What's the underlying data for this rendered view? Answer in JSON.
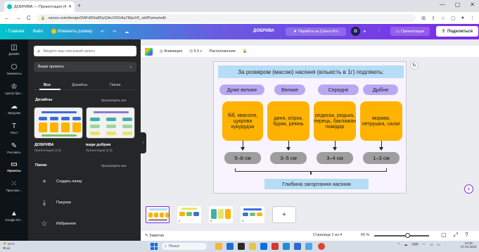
{
  "browser": {
    "tab_title": "ДОБРИВА — Презентация (4:3)",
    "url": "canva.com/design/DAFdD9a8DyQ/bcO5GAq78/jw1R_uk0Ppmw/edit",
    "nav": {
      "back": "←",
      "forward": "→",
      "reload": "C"
    }
  },
  "canva_bar": {
    "home": "Главная",
    "file": "Файл",
    "resize": "Изменить размер",
    "doc_name": "ДОБРИВА",
    "go_pro": "Перейти на Canva Pro",
    "avatar": "O",
    "add": "+",
    "present": "Презентация",
    "share": "Поделиться"
  },
  "rail": [
    {
      "label": "Дизайн",
      "icon": "layout-icon"
    },
    {
      "label": "Элементы",
      "icon": "shapes-icon"
    },
    {
      "label": "Центр бре...",
      "icon": "brand-icon"
    },
    {
      "label": "Загрузки",
      "icon": "upload-icon"
    },
    {
      "label": "Текст",
      "icon": "text-icon"
    },
    {
      "label": "Рисовать",
      "icon": "draw-icon"
    },
    {
      "label": "Проекты",
      "icon": "folder-icon"
    },
    {
      "label": "Приложе...",
      "icon": "apps-icon"
    },
    {
      "label": "Google Dri...",
      "icon": "drive-icon"
    }
  ],
  "panel": {
    "search_placeholder": "Введите ваш поисковый запрос",
    "project_selector": "Ваши проекты",
    "tabs": [
      "Все",
      "Дизайны",
      "Папки"
    ],
    "designs_heading": "Дизайны",
    "see_all": "Просмотреть все",
    "designs": [
      {
        "name": "ДОБРИВА",
        "sub": "Презентация (4:3)"
      },
      {
        "name": "види добрив",
        "sub": "Презентация (4:3)"
      }
    ],
    "folders_heading": "Папки",
    "folders_see_all": "Просмотреть все",
    "folders": [
      "Создать папку",
      "Покупки",
      "Избранное"
    ]
  },
  "context_bar": {
    "animation": "Анимация",
    "duration": "5.0 с",
    "position": "Расположение"
  },
  "slide": {
    "title": "За розміром (масою) насіння (кількість в 1г) подляють:",
    "categories": [
      "Дуже велике",
      "Велике",
      "Середнє",
      "Дрібне"
    ],
    "crops": [
      "біб, квасоля, цукрова кукурудза",
      "диня, огірок, буряк, ревінь",
      "редиска, редька, перець, баклажан помідор",
      "морква, петрушка, салат"
    ],
    "depths": [
      "5–8 см",
      "3–5 см",
      "3–4 см",
      "1–3 см"
    ],
    "depth_label": "Глибина загортання насіння"
  },
  "filmstrip": {
    "pages": [
      "1",
      "2",
      "3",
      "4"
    ],
    "add": "+"
  },
  "footer": {
    "notes": "Заметки",
    "page_info": "Страница 1 из 4",
    "zoom": "60 %"
  },
  "taskbar": {
    "temp": "14°C",
    "weather": "Ясно",
    "search": "Пошук",
    "lang": "УКР",
    "time": "10:25",
    "date": "27.04.2023"
  },
  "colors": {
    "pill": "#b7a8f2",
    "box": "#ffb300",
    "depth": "#9e9e9e",
    "banner": "#b7dcf6"
  }
}
